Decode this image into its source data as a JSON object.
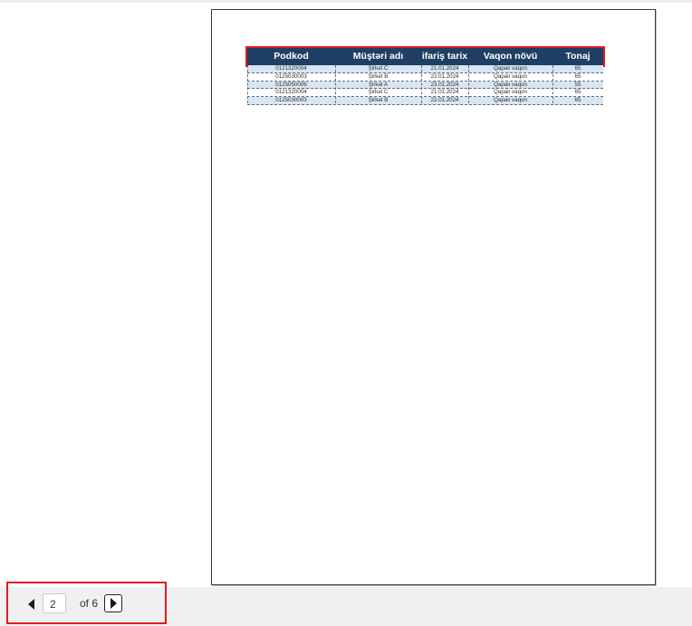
{
  "report": {
    "columns": [
      "Podkod",
      "Müştəri adı",
      "ifariş tarix",
      "Vaqon növü",
      "Tonaj"
    ],
    "rows": [
      [
        "0121320004",
        "Şirkət C",
        "21.01.2024",
        "Qapalı vaqon",
        "65"
      ],
      [
        "0125030003",
        "Şirkət B",
        "22.01.2024",
        "Qapalı vaqon",
        "65"
      ],
      [
        "0125050006",
        "Şirkət A",
        "23.01.2024",
        "Qapalı vaqon",
        "55"
      ],
      [
        "0121320004",
        "Şirkət C",
        "21.01.2024",
        "Qapalı vaqon",
        "65"
      ],
      [
        "0125030003",
        "Şirkət B",
        "22.01.2024",
        "Qapalı vaqon",
        "65"
      ]
    ],
    "colors": {
      "header_bg": "#1f3f64",
      "row_alt_bg": "#d6e6f5",
      "highlight": "#e11b22"
    }
  },
  "pager": {
    "current_page": "2",
    "of_label": "of 6",
    "prev_icon": "triangle-left-icon",
    "next_icon": "triangle-right-icon"
  }
}
